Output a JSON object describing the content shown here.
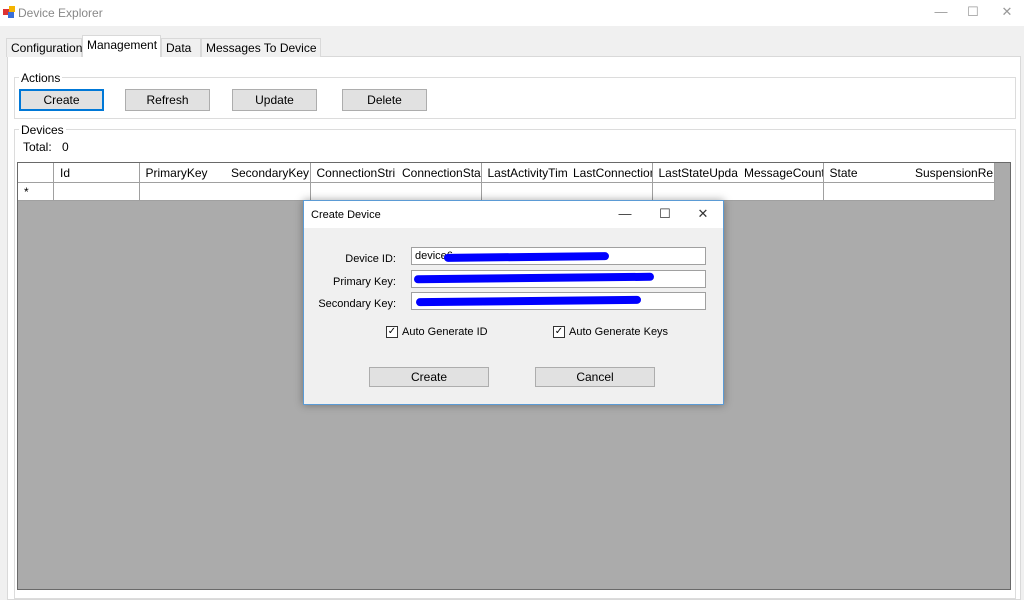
{
  "window": {
    "title": "Device Explorer"
  },
  "tabs": [
    {
      "label": "Configuration"
    },
    {
      "label": "Management"
    },
    {
      "label": "Data"
    },
    {
      "label": "Messages To Device"
    }
  ],
  "actions": {
    "group_label": "Actions",
    "create": "Create",
    "refresh": "Refresh",
    "update": "Update",
    "delete": "Delete"
  },
  "devices": {
    "group_label": "Devices",
    "total_label": "Total:",
    "total_value": "0",
    "columns": [
      "Id",
      "PrimaryKey",
      "SecondaryKey",
      "ConnectionStrir",
      "ConnectionStat",
      "LastActivityTim",
      "LastConnection",
      "LastStateUpda",
      "MessageCount",
      "State",
      "SuspensionRe"
    ],
    "new_row_marker": "*"
  },
  "dialog": {
    "title": "Create Device",
    "device_id_label": "Device ID:",
    "device_id_value": "device6",
    "primary_key_label": "Primary Key:",
    "primary_key_value": "",
    "secondary_key_label": "Secondary Key:",
    "secondary_key_value": "",
    "auto_id_label": "Auto Generate ID",
    "auto_id_checked": true,
    "auto_keys_label": "Auto Generate Keys",
    "auto_keys_checked": true,
    "create": "Create",
    "cancel": "Cancel"
  },
  "colors": {
    "accent": "#0078d7",
    "redaction": "#0000ff",
    "grid_bg": "#ababab"
  }
}
